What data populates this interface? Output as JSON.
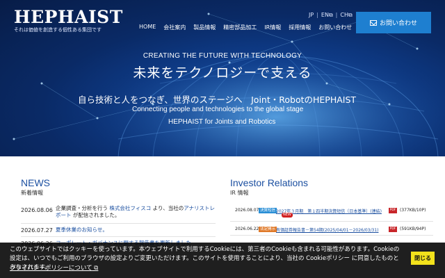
{
  "header": {
    "logo_text": "HEPHAIST",
    "logo_tagline": "それは価値を創造する個性ある集団です",
    "languages": [
      {
        "label": "JP"
      },
      {
        "label": "EN"
      },
      {
        "label": "CH"
      }
    ],
    "nav": [
      "HOME",
      "会社案内",
      "製品情報",
      "精密部品加工",
      "IR情報",
      "採用情報",
      "お問い合わせ"
    ],
    "contact_button": "お問い合わせ"
  },
  "hero": {
    "tagline": "CREATING THE FUTURE WITH TECHNOLOGY",
    "title": "未来をテクノロジーで支える",
    "line1": "自ら技術と人をつなぎ、世界のステージへ　Joint・RobotのHEPHAIST",
    "line2": "Connecting people and technologies to the global stage",
    "line3": "HEPHAIST for Joints and Robotics"
  },
  "news": {
    "title": "NEWS",
    "subtitle": "新着情報",
    "items": [
      {
        "date": "2026.08.06",
        "pre": "企業調査・分析を行う",
        "link1": "株式会社フィスコ",
        "mid": "より、当社の",
        "link2": "アナリストレポート",
        "post": "が配信されました。"
      },
      {
        "date": "2026.07.27",
        "text": "夏季休業のお知らせ。"
      },
      {
        "date": "2026.06.26",
        "text": "コーポレート・ガバナンスに関する報告書を更新しました"
      }
    ]
  },
  "ir": {
    "title": "Investor Relations",
    "subtitle": "IR 情報",
    "items": [
      {
        "date": "2026.08.07",
        "badge": "決算短信",
        "link": "2027年３月期　第１四半期決算短信〔日本基準〕(連結)",
        "new": "NEW",
        "pdf": "PDF",
        "size": "(377KB/10P)"
      },
      {
        "date": "2026.06.22",
        "badge": "法定開示",
        "link": "有価証券報告書－第54期(2025/04/01－2026/03/31)",
        "pdf": "PDF",
        "size": "(591KB/94P)"
      }
    ]
  },
  "cookie": {
    "text": "このウェブサイトではクッキーを使っています。本ウェブサイトで利用するCookieには、第三者のCookieも含まれる可能性があります。Cookieの設定は、いつでもご利用のブラウザの設定よりご変更いただけます。このサイトを使用することにより、当社の Cookieポリシー に同意したものとみなされます。",
    "policy_link": "プライバシーポリシーについて",
    "close_button": "閉じる"
  }
}
